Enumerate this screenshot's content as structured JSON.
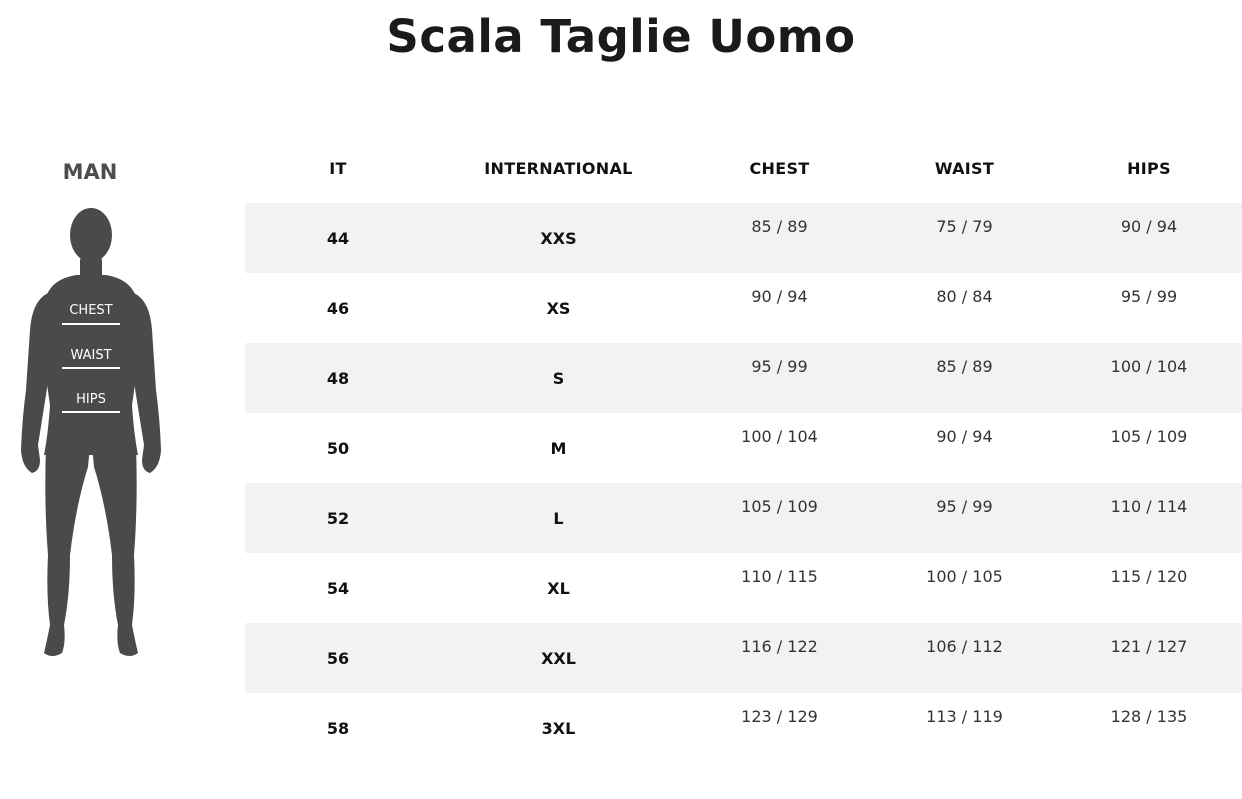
{
  "title": "Scala Taglie Uomo",
  "figure": {
    "label": "MAN",
    "markers": [
      "CHEST",
      "WAIST",
      "HIPS"
    ],
    "color": "#4a4a4a"
  },
  "table": {
    "headers": [
      "IT",
      "INTERNATIONAL",
      "CHEST",
      "WAIST",
      "HIPS"
    ],
    "rows": [
      [
        "44",
        "XXS",
        "85 / 89",
        "75 / 79",
        "90 / 94"
      ],
      [
        "46",
        "XS",
        "90 / 94",
        "80 / 84",
        "95 / 99"
      ],
      [
        "48",
        "S",
        "95 / 99",
        "85 / 89",
        "100 / 104"
      ],
      [
        "50",
        "M",
        "100 / 104",
        "90 / 94",
        "105 / 109"
      ],
      [
        "52",
        "L",
        "105 / 109",
        "95 / 99",
        "110 / 114"
      ],
      [
        "54",
        "XL",
        "110 / 115",
        "100 / 105",
        "115 / 120"
      ],
      [
        "56",
        "XXL",
        "116 / 122",
        "106 / 112",
        "121 / 127"
      ],
      [
        "58",
        "3XL",
        "123 / 129",
        "113 / 119",
        "128 / 135"
      ]
    ],
    "shade_color": "#f2f2f2"
  }
}
